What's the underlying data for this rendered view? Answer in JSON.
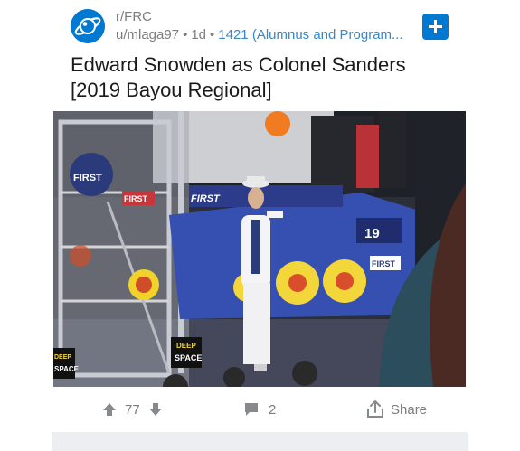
{
  "post": {
    "subreddit": "r/FRC",
    "author": "u/mlaga97",
    "age": "1d",
    "flair": "1421 (Alumnus and Program...",
    "title_line1": "Edward Snowden as Colonel Sanders",
    "title_line2": "[2019 Bayou Regional]",
    "image_signs": {
      "first_big": "FIRST",
      "first_a": "FIRST",
      "first_b": "FIRST",
      "first_c": "FIRST",
      "robot_number": "19",
      "deep_a": "DEEP",
      "space_a": "SPACE",
      "deep_b": "DEEP",
      "space_b": "SPACE"
    }
  },
  "actions": {
    "score": "77",
    "comments": "2",
    "share_label": "Share"
  },
  "icons": {
    "subreddit_avatar": "planet-icon",
    "add": "plus-icon",
    "upvote": "arrow-up-icon",
    "downvote": "arrow-down-icon",
    "comment": "comment-bubble-icon",
    "share": "share-icon"
  },
  "colors": {
    "accent": "#0079d3",
    "flair": "#3a86c8",
    "muted": "#7c7c7c"
  }
}
